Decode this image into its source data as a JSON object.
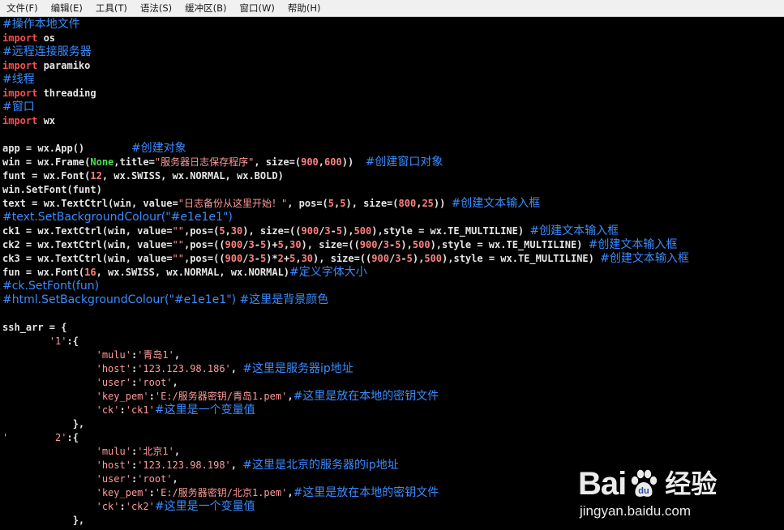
{
  "menu": {
    "items": [
      "文件(F)",
      "编辑(E)",
      "工具(T)",
      "语法(S)",
      "缓冲区(B)",
      "窗口(W)",
      "帮助(H)"
    ]
  },
  "colors": {
    "background": "#000000",
    "comment": "#3b8cff",
    "keyword": "#ff4d4d",
    "string": "#ff9a9a",
    "number": "#ff8080",
    "constant": "#4ee04e",
    "plain": "#e6e6e6"
  },
  "code": {
    "lines": [
      [
        {
          "t": "c",
          "s": "#操作本地文件"
        }
      ],
      [
        {
          "t": "k",
          "s": "import"
        },
        {
          "t": "p",
          "s": " os"
        }
      ],
      [
        {
          "t": "c",
          "s": "#远程连接服务器"
        }
      ],
      [
        {
          "t": "k",
          "s": "import"
        },
        {
          "t": "p",
          "s": " paramiko"
        }
      ],
      [
        {
          "t": "c",
          "s": "#线程"
        }
      ],
      [
        {
          "t": "k",
          "s": "import"
        },
        {
          "t": "p",
          "s": " threading"
        }
      ],
      [
        {
          "t": "c",
          "s": "#窗口"
        }
      ],
      [
        {
          "t": "k",
          "s": "import"
        },
        {
          "t": "p",
          "s": " wx"
        }
      ],
      [],
      [
        {
          "t": "p",
          "s": "app = wx.App()        "
        },
        {
          "t": "c",
          "s": "#创建对象"
        }
      ],
      [
        {
          "t": "p",
          "s": "win = wx.Frame("
        },
        {
          "t": "g",
          "s": "None"
        },
        {
          "t": "p",
          "s": ",title="
        },
        {
          "t": "s",
          "s": "\"服务器日志保存程序\""
        },
        {
          "t": "p",
          "s": ", size=("
        },
        {
          "t": "n",
          "s": "900"
        },
        {
          "t": "p",
          "s": ","
        },
        {
          "t": "n",
          "s": "600"
        },
        {
          "t": "p",
          "s": "))  "
        },
        {
          "t": "c",
          "s": "#创建窗口对象"
        }
      ],
      [
        {
          "t": "p",
          "s": "funt = wx.Font("
        },
        {
          "t": "n",
          "s": "12"
        },
        {
          "t": "p",
          "s": ", wx.SWISS, wx.NORMAL, wx.BOLD)"
        }
      ],
      [
        {
          "t": "p",
          "s": "win.SetFont(funt)"
        }
      ],
      [
        {
          "t": "p",
          "s": "text = wx.TextCtrl(win, value="
        },
        {
          "t": "s",
          "s": "\"日志备份从这里开始！\""
        },
        {
          "t": "p",
          "s": ", pos=("
        },
        {
          "t": "n",
          "s": "5"
        },
        {
          "t": "p",
          "s": ","
        },
        {
          "t": "n",
          "s": "5"
        },
        {
          "t": "p",
          "s": "), size=("
        },
        {
          "t": "n",
          "s": "800"
        },
        {
          "t": "p",
          "s": ","
        },
        {
          "t": "n",
          "s": "25"
        },
        {
          "t": "p",
          "s": ")) "
        },
        {
          "t": "c",
          "s": "#创建文本输入框"
        }
      ],
      [
        {
          "t": "c",
          "s": "#text.SetBackgroundColour(\"#e1e1e1\")"
        }
      ],
      [
        {
          "t": "p",
          "s": "ck1 = wx.TextCtrl(win, value="
        },
        {
          "t": "s",
          "s": "\"\""
        },
        {
          "t": "p",
          "s": ",pos=("
        },
        {
          "t": "n",
          "s": "5"
        },
        {
          "t": "p",
          "s": ","
        },
        {
          "t": "n",
          "s": "30"
        },
        {
          "t": "p",
          "s": "), size=(("
        },
        {
          "t": "n",
          "s": "900"
        },
        {
          "t": "p",
          "s": "/"
        },
        {
          "t": "n",
          "s": "3"
        },
        {
          "t": "p",
          "s": "-"
        },
        {
          "t": "n",
          "s": "5"
        },
        {
          "t": "p",
          "s": "),"
        },
        {
          "t": "n",
          "s": "500"
        },
        {
          "t": "p",
          "s": "),style = wx.TE_MULTILINE) "
        },
        {
          "t": "c",
          "s": "#创建文本输入框"
        }
      ],
      [
        {
          "t": "p",
          "s": "ck2 = wx.TextCtrl(win, value="
        },
        {
          "t": "s",
          "s": "\"\""
        },
        {
          "t": "p",
          "s": ",pos=(("
        },
        {
          "t": "n",
          "s": "900"
        },
        {
          "t": "p",
          "s": "/"
        },
        {
          "t": "n",
          "s": "3"
        },
        {
          "t": "p",
          "s": "-"
        },
        {
          "t": "n",
          "s": "5"
        },
        {
          "t": "p",
          "s": ")+"
        },
        {
          "t": "n",
          "s": "5"
        },
        {
          "t": "p",
          "s": ","
        },
        {
          "t": "n",
          "s": "30"
        },
        {
          "t": "p",
          "s": "), size=(("
        },
        {
          "t": "n",
          "s": "900"
        },
        {
          "t": "p",
          "s": "/"
        },
        {
          "t": "n",
          "s": "3"
        },
        {
          "t": "p",
          "s": "-"
        },
        {
          "t": "n",
          "s": "5"
        },
        {
          "t": "p",
          "s": "),"
        },
        {
          "t": "n",
          "s": "500"
        },
        {
          "t": "p",
          "s": "),style = wx.TE_MULTILINE) "
        },
        {
          "t": "c",
          "s": "#创建文本输入框"
        }
      ],
      [
        {
          "t": "p",
          "s": "ck3 = wx.TextCtrl(win, value="
        },
        {
          "t": "s",
          "s": "\"\""
        },
        {
          "t": "p",
          "s": ",pos=(("
        },
        {
          "t": "n",
          "s": "900"
        },
        {
          "t": "p",
          "s": "/"
        },
        {
          "t": "n",
          "s": "3"
        },
        {
          "t": "p",
          "s": "-"
        },
        {
          "t": "n",
          "s": "5"
        },
        {
          "t": "p",
          "s": ")*"
        },
        {
          "t": "n",
          "s": "2"
        },
        {
          "t": "p",
          "s": "+"
        },
        {
          "t": "n",
          "s": "5"
        },
        {
          "t": "p",
          "s": ","
        },
        {
          "t": "n",
          "s": "30"
        },
        {
          "t": "p",
          "s": "), size=(("
        },
        {
          "t": "n",
          "s": "900"
        },
        {
          "t": "p",
          "s": "/"
        },
        {
          "t": "n",
          "s": "3"
        },
        {
          "t": "p",
          "s": "-"
        },
        {
          "t": "n",
          "s": "5"
        },
        {
          "t": "p",
          "s": "),"
        },
        {
          "t": "n",
          "s": "500"
        },
        {
          "t": "p",
          "s": "),style = wx.TE_MULTILINE) "
        },
        {
          "t": "c",
          "s": "#创建文本输入框"
        }
      ],
      [
        {
          "t": "p",
          "s": "fun = wx.Font("
        },
        {
          "t": "n",
          "s": "16"
        },
        {
          "t": "p",
          "s": ", wx.SWISS, wx.NORMAL, wx.NORMAL)"
        },
        {
          "t": "c",
          "s": "#定义字体大小"
        }
      ],
      [
        {
          "t": "c",
          "s": "#ck.SetFont(fun)"
        }
      ],
      [
        {
          "t": "c",
          "s": "#html.SetBackgroundColour(\"#e1e1e1\") #这里是背景颜色"
        }
      ],
      [],
      [
        {
          "t": "p",
          "s": "ssh_arr = {"
        }
      ],
      [
        {
          "t": "p",
          "s": "        "
        },
        {
          "t": "s",
          "s": "'1'"
        },
        {
          "t": "p",
          "s": ":{"
        }
      ],
      [
        {
          "t": "p",
          "s": "                "
        },
        {
          "t": "s",
          "s": "'mulu'"
        },
        {
          "t": "p",
          "s": ":"
        },
        {
          "t": "s",
          "s": "'青岛1'"
        },
        {
          "t": "p",
          "s": ","
        }
      ],
      [
        {
          "t": "p",
          "s": "                "
        },
        {
          "t": "s",
          "s": "'host'"
        },
        {
          "t": "p",
          "s": ":"
        },
        {
          "t": "s",
          "s": "'123.123.98.186'"
        },
        {
          "t": "p",
          "s": ", "
        },
        {
          "t": "c",
          "s": "#这里是服务器ip地址"
        }
      ],
      [
        {
          "t": "p",
          "s": "                "
        },
        {
          "t": "s",
          "s": "'user'"
        },
        {
          "t": "p",
          "s": ":"
        },
        {
          "t": "s",
          "s": "'root'"
        },
        {
          "t": "p",
          "s": ","
        }
      ],
      [
        {
          "t": "p",
          "s": "                "
        },
        {
          "t": "s",
          "s": "'key_pem'"
        },
        {
          "t": "p",
          "s": ":"
        },
        {
          "t": "s",
          "s": "'E:/服务器密钥/青岛1.pem'"
        },
        {
          "t": "p",
          "s": ","
        },
        {
          "t": "c",
          "s": "#这里是放在本地的密钥文件"
        }
      ],
      [
        {
          "t": "p",
          "s": "                "
        },
        {
          "t": "s",
          "s": "'ck'"
        },
        {
          "t": "p",
          "s": ":"
        },
        {
          "t": "s",
          "s": "'ck1'"
        },
        {
          "t": "c",
          "s": "#这里是一个变量值"
        }
      ],
      [
        {
          "t": "p",
          "s": "            },"
        }
      ],
      [
        {
          "t": "s",
          "s": "'        2'"
        },
        {
          "t": "p",
          "s": ":{"
        }
      ],
      [
        {
          "t": "p",
          "s": "                "
        },
        {
          "t": "s",
          "s": "'mulu'"
        },
        {
          "t": "p",
          "s": ":"
        },
        {
          "t": "s",
          "s": "'北京1'"
        },
        {
          "t": "p",
          "s": ","
        }
      ],
      [
        {
          "t": "p",
          "s": "                "
        },
        {
          "t": "s",
          "s": "'host'"
        },
        {
          "t": "p",
          "s": ":"
        },
        {
          "t": "s",
          "s": "'123.123.98.198'"
        },
        {
          "t": "p",
          "s": ", "
        },
        {
          "t": "c",
          "s": "#这里是北京的服务器的ip地址"
        }
      ],
      [
        {
          "t": "p",
          "s": "                "
        },
        {
          "t": "s",
          "s": "'user'"
        },
        {
          "t": "p",
          "s": ":"
        },
        {
          "t": "s",
          "s": "'root'"
        },
        {
          "t": "p",
          "s": ","
        }
      ],
      [
        {
          "t": "p",
          "s": "                "
        },
        {
          "t": "s",
          "s": "'key_pem'"
        },
        {
          "t": "p",
          "s": ":"
        },
        {
          "t": "s",
          "s": "'E:/服务器密钥/北京1.pem'"
        },
        {
          "t": "p",
          "s": ","
        },
        {
          "t": "c",
          "s": "#这里是放在本地的密钥文件"
        }
      ],
      [
        {
          "t": "p",
          "s": "                "
        },
        {
          "t": "s",
          "s": "'ck'"
        },
        {
          "t": "p",
          "s": ":"
        },
        {
          "t": "s",
          "s": "'ck2'"
        },
        {
          "t": "c",
          "s": "#这里是一个变量值"
        }
      ],
      [
        {
          "t": "p",
          "s": "            },"
        }
      ]
    ]
  },
  "watermark": {
    "logo_left": "Bai",
    "logo_right": "u",
    "logo_cn": "经验",
    "url": "jingyan.baidu.com",
    "paw_icon": "baidu-paw-icon"
  }
}
